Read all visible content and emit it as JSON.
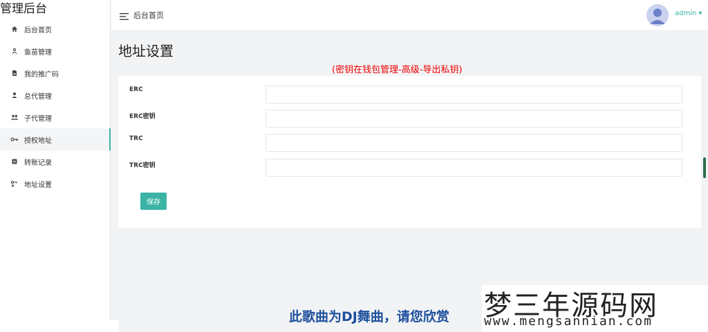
{
  "app": {
    "brand": "管理后台"
  },
  "sidebar": {
    "items": [
      {
        "label": "后台首页",
        "icon": "home-icon"
      },
      {
        "label": "鱼苗管理",
        "icon": "fish-icon"
      },
      {
        "label": "我的推广码",
        "icon": "document-icon"
      },
      {
        "label": "总代管理",
        "icon": "user-icon"
      },
      {
        "label": "子代管理",
        "icon": "users-icon"
      },
      {
        "label": "授权地址",
        "icon": "key-icon",
        "active": true
      },
      {
        "label": "转账记录",
        "icon": "list-icon"
      },
      {
        "label": "地址设置",
        "icon": "settings-key-icon"
      }
    ]
  },
  "header": {
    "breadcrumb": "后台首页",
    "user": "admin",
    "caret": "▾"
  },
  "main": {
    "title": "地址设置",
    "notice": "(密钥在钱包管理-高级-导出私钥)",
    "fields": [
      {
        "label": "ERC",
        "value": "",
        "placeholder": ""
      },
      {
        "label": "ERC密钥",
        "value": "",
        "placeholder": ""
      },
      {
        "label": "TRC",
        "value": "",
        "placeholder": ""
      },
      {
        "label": "TRC密钥",
        "value": "",
        "placeholder": ""
      }
    ],
    "save_label": "保存"
  },
  "overlay": {
    "subtitle": "此歌曲为DJ舞曲，请您欣赏",
    "watermark_title": "梦三年源码网",
    "watermark_url": "www.mengsannian.com"
  },
  "colors": {
    "accent": "#3bb4a6",
    "notice": "#ee0000",
    "background": "#f2f3f5"
  }
}
